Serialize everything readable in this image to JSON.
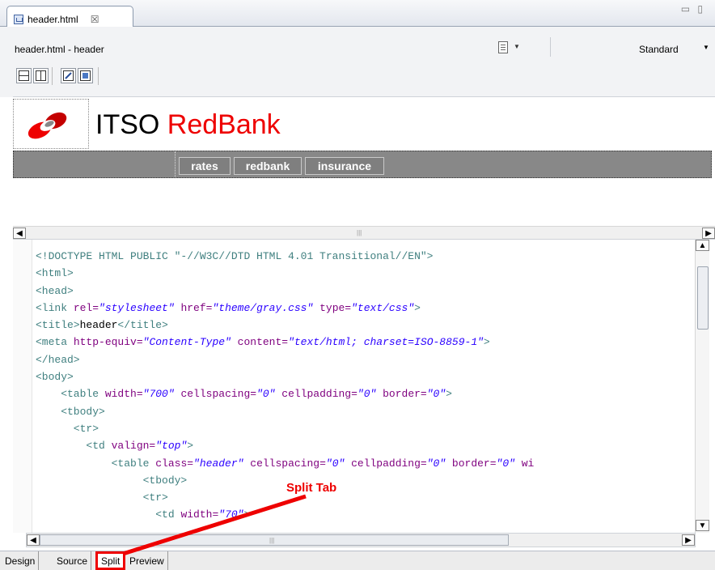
{
  "editor_tab": {
    "label": "header.html"
  },
  "toolbar": {
    "title": "header.html - header",
    "page_mode": "Standard"
  },
  "design": {
    "brand": {
      "part1": "ITSO ",
      "part2": "RedBank"
    },
    "nav": [
      "rates",
      "redbank",
      "insurance"
    ]
  },
  "source_lines": [
    [
      [
        "tag",
        "<!DOCTYPE HTML PUBLIC \"-//W3C//DTD HTML 4.01 Transitional//EN\">"
      ]
    ],
    [
      [
        "tag",
        "<html>"
      ]
    ],
    [
      [
        "tag",
        "<head>"
      ]
    ],
    [
      [
        "tag",
        "<link "
      ],
      [
        "attr",
        "rel="
      ],
      [
        "val",
        "\"stylesheet\""
      ],
      [
        "attr",
        " href="
      ],
      [
        "val",
        "\"theme/gray.css\""
      ],
      [
        "attr",
        " type="
      ],
      [
        "val",
        "\"text/css\""
      ],
      [
        "tag",
        ">"
      ]
    ],
    [
      [
        "tag",
        "<title>"
      ],
      [
        "txt",
        "header"
      ],
      [
        "tag",
        "</title>"
      ]
    ],
    [
      [
        "tag",
        "<meta "
      ],
      [
        "attr",
        "http-equiv="
      ],
      [
        "val",
        "\"Content-Type\""
      ],
      [
        "attr",
        " content="
      ],
      [
        "val",
        "\"text/html; charset=ISO-8859-1\""
      ],
      [
        "tag",
        ">"
      ]
    ],
    [
      [
        "tag",
        "</head>"
      ]
    ],
    [
      [
        "tag",
        "<body>"
      ]
    ],
    [
      [
        "tag",
        "    <table "
      ],
      [
        "attr",
        "width="
      ],
      [
        "val",
        "\"700\""
      ],
      [
        "attr",
        " cellspacing="
      ],
      [
        "val",
        "\"0\""
      ],
      [
        "attr",
        " cellpadding="
      ],
      [
        "val",
        "\"0\""
      ],
      [
        "attr",
        " border="
      ],
      [
        "val",
        "\"0\""
      ],
      [
        "tag",
        ">"
      ]
    ],
    [
      [
        "tag",
        "    <tbody>"
      ]
    ],
    [
      [
        "tag",
        "      <tr>"
      ]
    ],
    [
      [
        "tag",
        "        <td "
      ],
      [
        "attr",
        "valign="
      ],
      [
        "val",
        "\"top\""
      ],
      [
        "tag",
        ">"
      ]
    ],
    [
      [
        "tag",
        "            <table "
      ],
      [
        "attr",
        "class="
      ],
      [
        "val",
        "\"header\""
      ],
      [
        "attr",
        " cellspacing="
      ],
      [
        "val",
        "\"0\""
      ],
      [
        "attr",
        " cellpadding="
      ],
      [
        "val",
        "\"0\""
      ],
      [
        "attr",
        " border="
      ],
      [
        "val",
        "\"0\""
      ],
      [
        "attr",
        " wi"
      ]
    ],
    [
      [
        "tag",
        "                 <tbody>"
      ]
    ],
    [
      [
        "tag",
        "                 <tr>"
      ]
    ],
    [
      [
        "tag",
        "                   <td "
      ],
      [
        "attr",
        "width="
      ],
      [
        "val",
        "\"70\""
      ],
      [
        "tag",
        ">"
      ]
    ]
  ],
  "page_tabs": [
    "Design",
    "Source",
    "Split",
    "Preview"
  ],
  "annotation": {
    "label": "Split Tab"
  },
  "colors": {
    "brand_red": "#e00000",
    "tag": "#3f7f7f",
    "attr": "#7f007f",
    "value": "#2a00ff",
    "callout": "#e00000"
  }
}
